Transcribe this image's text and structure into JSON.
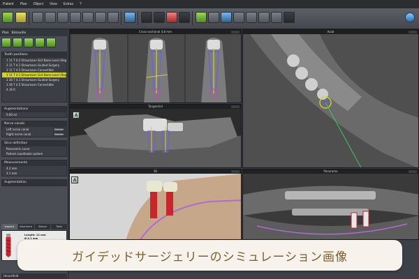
{
  "menu": [
    "Patient",
    "Plan",
    "Object",
    "View",
    "Extras",
    "?"
  ],
  "plan_panel": {
    "title": "Plan",
    "name": "Bimaxille",
    "sections": [
      {
        "title": "Tooth positions",
        "rows": [
          {
            "text": "1 11 T 6.5 Straumann SLA Bone Level (Regular CrossFit...)",
            "selected": false
          },
          {
            "text": "2 11 T 4.1 Straumann Guided Surgery",
            "selected": false
          },
          {
            "text": "3 11 T 4.5 Straumann Convertible",
            "selected": false
          },
          {
            "text": "1 11 T 4.1 Straumann SLA Bone Level (Regular...)",
            "selected": true
          },
          {
            "text": "2 36 T 4.1 Straumann Guided Surgery",
            "selected": false
          },
          {
            "text": "3 36 T 4.5 Straumann Convertible",
            "selected": false
          },
          {
            "text": "4 16 R",
            "selected": false
          }
        ]
      },
      {
        "title": "Augmentations",
        "rows": [
          {
            "text": "0.00 ml",
            "selected": false
          }
        ]
      },
      {
        "title": "Nerve canals",
        "rows": [
          {
            "text": "Left nerve canal",
            "button": "Delete",
            "selected": false
          },
          {
            "text": "Right nerve canal",
            "button": "Delete",
            "selected": false
          }
        ]
      },
      {
        "title": "Slice definition",
        "rows": [
          {
            "text": "Panoramic curve",
            "selected": false
          },
          {
            "text": "Patient coordinate system",
            "selected": false
          }
        ]
      },
      {
        "title": "Measurements",
        "rows": [
          {
            "text": "4.2 mm",
            "selected": false
          },
          {
            "text": "3.1 mm",
            "selected": false
          }
        ]
      },
      {
        "title": "Augmentation",
        "rows": []
      }
    ],
    "implant_tabs": [
      "Implant",
      "Abutment",
      "Sleeve",
      "Tools"
    ],
    "implant": {
      "length": "Length: 12 mm",
      "diameter": "Ø 4.1 mm",
      "lines": [
        "Straumann",
        "SLA Bone Level (Regular CrossFit®)",
        "Total length: 12.1 mm",
        "Insertion depth: 12 mm",
        "Art.-Nr: 021.4512"
      ]
    },
    "footer": "Hounsfield"
  },
  "views": {
    "cross_sectional": "Cross-sectional 4.8 mm",
    "axial": "Axial",
    "tangential": "Tangential",
    "three_d": "3D",
    "panoramic": "Panorama"
  },
  "caption": "ガイデッドサージェリーのシミュレーション画像",
  "colors": {
    "accent": "#d3d12b",
    "caption_text": "#7b5e2b",
    "caption_bg": "#f7f3ec"
  }
}
